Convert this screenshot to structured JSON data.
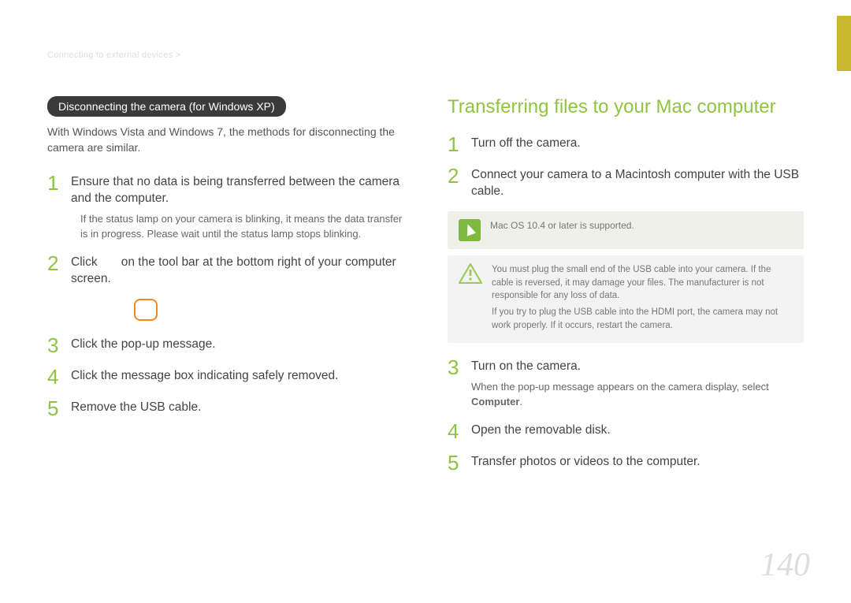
{
  "breadcrumb": "Connecting to external devices >",
  "page_number": "140",
  "left": {
    "pill": "Disconnecting the camera (for Windows XP)",
    "intro": "With Windows Vista and Windows 7, the methods for disconnecting the camera are similar.",
    "steps": {
      "s1": {
        "num": "1",
        "body": "Ensure that no data is being transferred between the camera and the computer.",
        "sub": "If the status lamp on your camera is blinking, it means the data transfer is in progress. Please wait until the status lamp stops blinking."
      },
      "s2": {
        "num": "2",
        "body_a": "Click ",
        "body_b": " on the tool bar at the bottom right of your computer screen."
      },
      "s3": {
        "num": "3",
        "body": "Click the pop-up message."
      },
      "s4": {
        "num": "4",
        "body": "Click the message box indicating safely removed."
      },
      "s5": {
        "num": "5",
        "body": "Remove the USB cable."
      }
    }
  },
  "right": {
    "title": "Transferring files to your Mac computer",
    "steps": {
      "s1": {
        "num": "1",
        "body": "Turn off the camera."
      },
      "s2": {
        "num": "2",
        "body": "Connect your camera to a Macintosh computer with the USB cable."
      },
      "s3": {
        "num": "3",
        "body": "Turn on the camera.",
        "sub_a": "When the pop-up message appears on the camera display, select ",
        "sub_b": "Computer",
        "sub_c": "."
      },
      "s4": {
        "num": "4",
        "body": "Open the removable disk."
      },
      "s5": {
        "num": "5",
        "body": "Transfer photos or videos to the computer."
      }
    },
    "note": "Mac OS 10.4 or later is supported.",
    "warn": {
      "p1": "You must plug the small end of the USB cable into your camera. If the cable is reversed, it may damage your files. The manufacturer is not responsible for any loss of data.",
      "p2": "If you try to plug the USB cable into the HDMI port, the camera may not work properly. If it occurs, restart the camera."
    }
  }
}
